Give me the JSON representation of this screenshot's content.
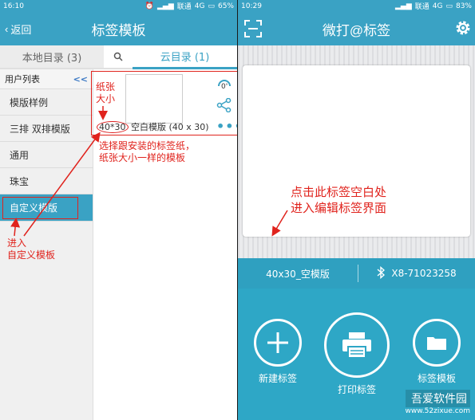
{
  "left": {
    "status": {
      "time": "16:10",
      "carrier": "联通",
      "network": "4G",
      "battery": "65%"
    },
    "header": {
      "back_label": "返回",
      "title": "标签模板"
    },
    "tabs": {
      "local": "本地目录 (3)",
      "cloud": "云目录 (1)"
    },
    "sidebar": {
      "title": "用户列表",
      "collapse": "<<",
      "items": [
        "模版样例",
        "三排 双排模版",
        "通用",
        "珠宝",
        "自定义模版"
      ]
    },
    "template": {
      "size": "40*30",
      "name": "空白模版 (40 x 30)",
      "rotation": "0'"
    },
    "annotations": {
      "paper_size": "纸张\n大小",
      "choose": "选择跟安装的标签纸，\n纸张大小一样的模板",
      "enter": "进入\n自定义模板"
    }
  },
  "right": {
    "status": {
      "time": "10:29",
      "carrier": "联通",
      "network": "4G",
      "battery": "83%"
    },
    "header": {
      "title": "微打@标签"
    },
    "annotation": "点击此标签空白处\n进入编辑标签界面",
    "info": {
      "template": "40x30_空模版",
      "device": "X8-71023258"
    },
    "actions": [
      "新建标签",
      "打印标签",
      "标签模板"
    ],
    "watermark": {
      "main": "吾爱软件园",
      "sub": "www.52zixue.com"
    }
  },
  "colors": {
    "accent": "#3aa2c4",
    "annotation": "#e0231d"
  }
}
